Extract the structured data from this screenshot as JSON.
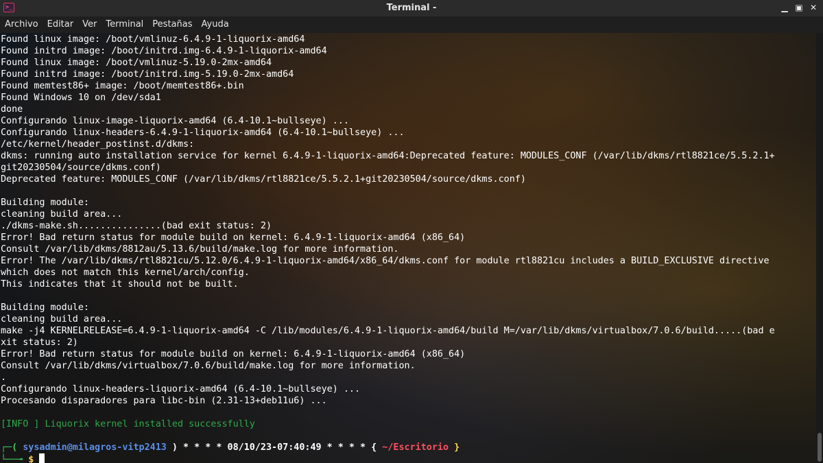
{
  "window": {
    "title": "Terminal -"
  },
  "menu": [
    "Archivo",
    "Editar",
    "Ver",
    "Terminal",
    "Pestañas",
    "Ayuda"
  ],
  "terminal_lines": [
    "Found linux image: /boot/vmlinuz-6.4.9-1-liquorix-amd64",
    "Found initrd image: /boot/initrd.img-6.4.9-1-liquorix-amd64",
    "Found linux image: /boot/vmlinuz-5.19.0-2mx-amd64",
    "Found initrd image: /boot/initrd.img-5.19.0-2mx-amd64",
    "Found memtest86+ image: /boot/memtest86+.bin",
    "Found Windows 10 on /dev/sda1",
    "done",
    "Configurando linux-image-liquorix-amd64 (6.4-10.1~bullseye) ...",
    "Configurando linux-headers-6.4.9-1-liquorix-amd64 (6.4-10.1~bullseye) ...",
    "/etc/kernel/header_postinst.d/dkms:",
    "dkms: running auto installation service for kernel 6.4.9-1-liquorix-amd64:Deprecated feature: MODULES_CONF (/var/lib/dkms/rtl8821ce/5.5.2.1+",
    "git20230504/source/dkms.conf)",
    "Deprecated feature: MODULES_CONF (/var/lib/dkms/rtl8821ce/5.5.2.1+git20230504/source/dkms.conf)",
    "",
    "Building module:",
    "cleaning build area...",
    "./dkms-make.sh...............(bad exit status: 2)",
    "Error! Bad return status for module build on kernel: 6.4.9-1-liquorix-amd64 (x86_64)",
    "Consult /var/lib/dkms/8812au/5.13.6/build/make.log for more information.",
    "Error! The /var/lib/dkms/rtl8821cu/5.12.0/6.4.9-1-liquorix-amd64/x86_64/dkms.conf for module rtl8821cu includes a BUILD_EXCLUSIVE directive",
    "which does not match this kernel/arch/config.",
    "This indicates that it should not be built.",
    "",
    "Building module:",
    "cleaning build area...",
    "make -j4 KERNELRELEASE=6.4.9-1-liquorix-amd64 -C /lib/modules/6.4.9-1-liquorix-amd64/build M=/var/lib/dkms/virtualbox/7.0.6/build.....(bad e",
    "xit status: 2)",
    "Error! Bad return status for module build on kernel: 6.4.9-1-liquorix-amd64 (x86_64)",
    "Consult /var/lib/dkms/virtualbox/7.0.6/build/make.log for more information.",
    ".",
    "Configurando linux-headers-liquorix-amd64 (6.4-10.1~bullseye) ...",
    "Procesando disparadores para libc-bin (2.31-13+deb11u6) ..."
  ],
  "info_line": "[INFO ] Liquorix kernel installed successfully",
  "prompt": {
    "corner_top": "┌─(",
    "user_host": " sysadmin@milagros-vitp2413 ",
    "separator": ") * * * * ",
    "datetime": "08/10/23-07:40:49",
    "stars": " * * * * { ",
    "cwd": "~/Escritorio",
    "close": " }",
    "corner_bottom": "└──╼",
    "symbol": " $ "
  },
  "colors": {
    "titlebar_bg": "#2b2b2b",
    "menubar_bg": "#1f1f1f",
    "text": "#ffffff",
    "info_green": "#2fa84a",
    "prompt_green": "#3fc25a",
    "prompt_blue": "#5a8ee6",
    "prompt_red": "#ff4f5f",
    "prompt_yellow": "#ffd84a"
  }
}
